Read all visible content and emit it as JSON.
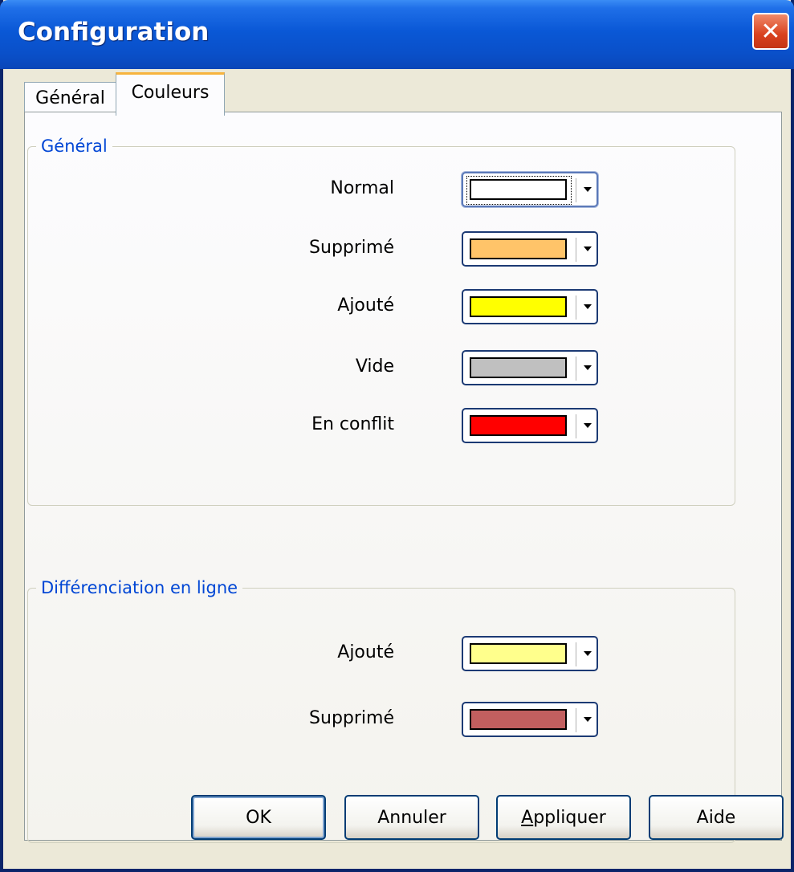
{
  "window": {
    "title": "Configuration"
  },
  "tabs": [
    {
      "label": "Général",
      "active": false
    },
    {
      "label": "Couleurs",
      "active": true
    }
  ],
  "groups": {
    "general": {
      "title": "Général",
      "rows": [
        {
          "label": "Normal",
          "color": "#ffffff"
        },
        {
          "label": "Supprimé",
          "color": "#ffc469"
        },
        {
          "label": "Ajouté",
          "color": "#ffff00"
        },
        {
          "label": "Vide",
          "color": "#c0c0c0"
        },
        {
          "label": "En conflit",
          "color": "#ff0000"
        }
      ]
    },
    "inline": {
      "title": "Différenciation en ligne",
      "rows": [
        {
          "label": "Ajouté",
          "color": "#ffff8c"
        },
        {
          "label": "Supprimé",
          "color": "#c25f5f"
        }
      ]
    }
  },
  "buttons": {
    "ok": "OK",
    "cancel": "Annuler",
    "apply_prefix": "A",
    "apply_rest": "ppliquer",
    "help": "Aide"
  }
}
